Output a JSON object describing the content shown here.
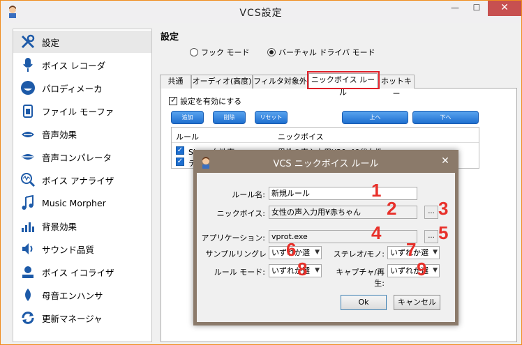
{
  "window": {
    "title": "VCS設定",
    "border_color": "#f08c1e",
    "close_color": "#c75050"
  },
  "sidebar": {
    "items": [
      {
        "label": "設定",
        "icon": "tools-icon"
      },
      {
        "label": "ボイス レコーダ",
        "icon": "microphone-icon"
      },
      {
        "label": "パロディメーカ",
        "icon": "mouth-icon"
      },
      {
        "label": "ファイル モーファ",
        "icon": "file-morph-icon"
      },
      {
        "label": "音声効果",
        "icon": "lips-icon"
      },
      {
        "label": "音声コンパレータ",
        "icon": "lips-compare-icon"
      },
      {
        "label": "ボイス アナライザ",
        "icon": "analyzer-icon"
      },
      {
        "label": "Music Morpher",
        "icon": "music-note-icon"
      },
      {
        "label": "背景効果",
        "icon": "background-effect-icon"
      },
      {
        "label": "サウンド品質",
        "icon": "speaker-icon"
      },
      {
        "label": "ボイス イコライザ",
        "icon": "equalizer-icon"
      },
      {
        "label": "母音エンハンサ",
        "icon": "vowel-enhancer-icon"
      },
      {
        "label": "更新マネージャ",
        "icon": "update-icon"
      }
    ]
  },
  "main": {
    "heading": "設定",
    "mode_hook": "フック モード",
    "mode_virtual": "バーチャル ドライバ モード",
    "tabs": [
      "共通",
      "オーディオ(高度)",
      "フィルタ対象外",
      "ニックボイス ルール",
      "ホットキー"
    ],
    "enable_checkbox": "設定を有効にする",
    "buttons": {
      "add": "追加",
      "delete": "削除",
      "reset": "リセット",
      "up": "上へ",
      "down": "下へ"
    },
    "list": {
      "columns": [
        "ルール",
        "ニックボイス"
      ],
      "rows": [
        {
          "rule": "Skype女性声",
          "nickvoice": "男性の声入力用¥30_40代女性"
        },
        {
          "rule": "テ",
          "nickvoice": ""
        }
      ]
    },
    "highlight_color": "#e0202a"
  },
  "dialog": {
    "title": "VCS ニックボイス ルール",
    "rule_name_label": "ルール名:",
    "rule_name_value": "新規ルール",
    "nickvoice_label": "ニックボイス:",
    "nickvoice_value": "女性の声入力用¥赤ちゃん",
    "app_label": "アプリケーション:",
    "app_value": "vprot.exe",
    "browse": "...",
    "sampling_label": "サンプルリングレ",
    "sampling_value": "いずれか選",
    "stereo_label": "ステレオ/モノ:",
    "stereo_value": "いずれか選",
    "rulemode_label": "ルール モード:",
    "rulemode_value": "いずれか選",
    "capture_label": "キャプチャ/再生:",
    "capture_value": "いずれか選",
    "ok": "Ok",
    "cancel": "キャンセル",
    "title_color": "#8b7a6a"
  },
  "callouts": [
    "1",
    "2",
    "3",
    "4",
    "5",
    "6",
    "7",
    "8",
    "9"
  ]
}
